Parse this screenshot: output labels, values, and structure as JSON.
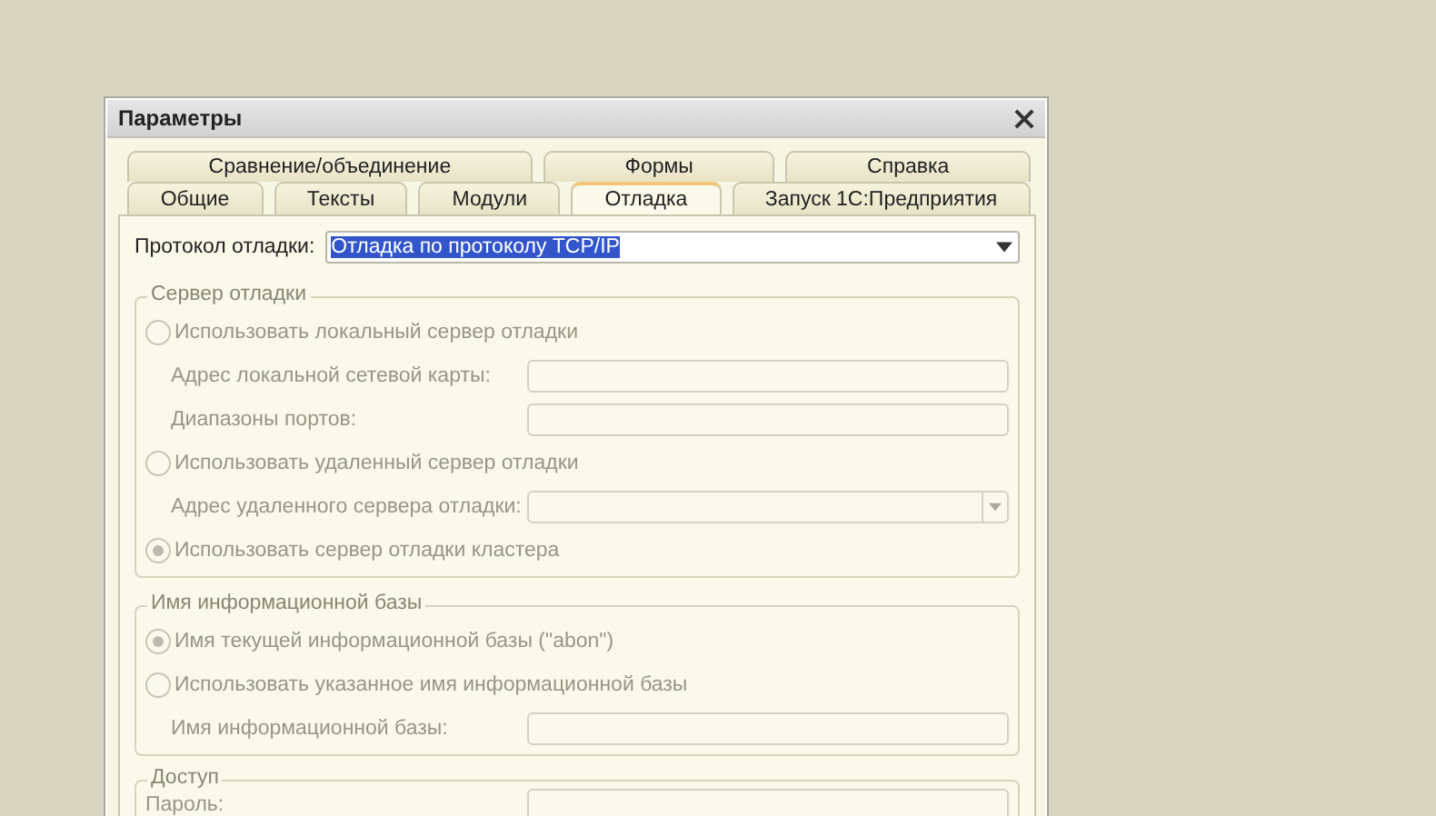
{
  "window": {
    "title": "Параметры"
  },
  "tabs": [
    [
      {
        "label": "Сравнение/объединение",
        "selected": false
      },
      {
        "label": "Формы",
        "selected": false
      },
      {
        "label": "Справка",
        "selected": false
      }
    ],
    [
      {
        "label": "Общие",
        "selected": false
      },
      {
        "label": "Тексты",
        "selected": false
      },
      {
        "label": "Модули",
        "selected": false
      },
      {
        "label": "Отладка",
        "selected": true
      },
      {
        "label": "Запуск 1С:Предприятия",
        "selected": false
      }
    ]
  ],
  "protocol": {
    "label": "Протокол отладки:",
    "value": "Отладка по протоколу TCP/IP",
    "highlighted": true
  },
  "groups": [
    {
      "title": "Сервер отладки",
      "items": [
        {
          "kind": "radio",
          "label": "Использовать локальный сервер отладки",
          "selected": false,
          "disabled": true,
          "children": [
            {
              "kind": "field",
              "label": "Адрес локальной сетевой карты:",
              "disabled": true
            },
            {
              "kind": "field",
              "label": "Диапазоны портов:",
              "disabled": true
            }
          ]
        },
        {
          "kind": "radio",
          "label": "Использовать удаленный сервер отладки",
          "selected": false,
          "disabled": true,
          "children": [
            {
              "kind": "combo",
              "label": "Адрес удаленного сервера отладки:",
              "disabled": true
            }
          ]
        },
        {
          "kind": "radio",
          "label": "Использовать сервер отладки кластера",
          "selected": true,
          "disabled": true
        }
      ]
    },
    {
      "title": "Имя информационной базы",
      "items": [
        {
          "kind": "radio",
          "label": "Имя текущей информационной базы (\"abon\")",
          "selected": true,
          "disabled": true
        },
        {
          "kind": "radio",
          "label": "Использовать указанное имя информационной базы",
          "selected": false,
          "disabled": true,
          "children": [
            {
              "kind": "field",
              "label": "Имя информационной базы:",
              "disabled": true
            }
          ]
        }
      ]
    },
    {
      "title": "Доступ",
      "items": [
        {
          "kind": "field",
          "label": "Пароль:",
          "disabled": true
        }
      ]
    }
  ]
}
